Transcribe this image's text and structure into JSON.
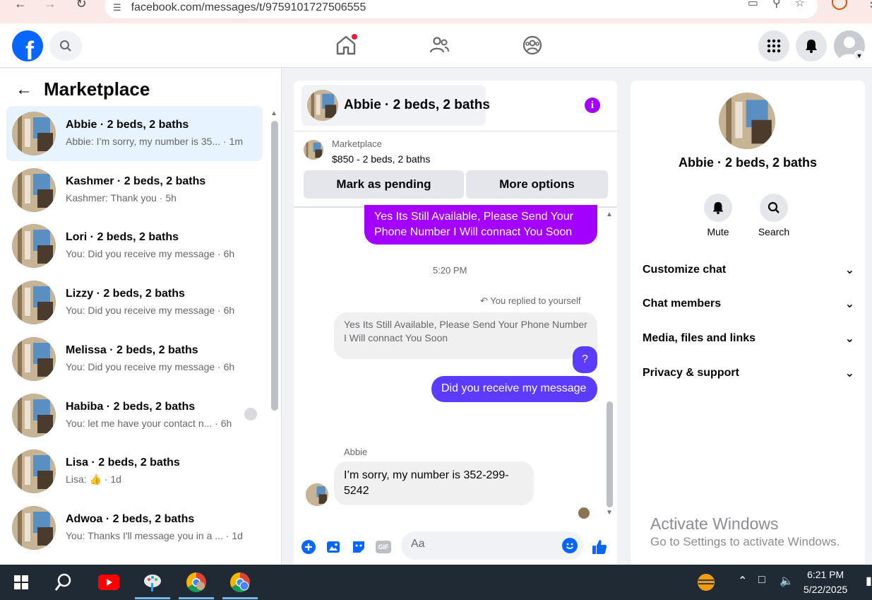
{
  "browser": {
    "url": "facebook.com/messages/t/9759101727506555"
  },
  "topbar": {
    "logo_letter": "f"
  },
  "left": {
    "title": "Marketplace",
    "conversations": [
      {
        "name": "Abbie · 2 beds, 2 baths",
        "preview": "Abbie: I’m sorry, my number is 35... · 1m"
      },
      {
        "name": "Kashmer · 2 beds, 2 baths",
        "preview": "Kashmer: Thank you · 5h"
      },
      {
        "name": "Lori · 2 beds, 2 baths",
        "preview": "You: Did you receive my message · 6h"
      },
      {
        "name": "Lizzy · 2 beds, 2 baths",
        "preview": "You: Did you receive my message · 6h"
      },
      {
        "name": "Melissa · 2 beds, 2 baths",
        "preview": "You: Did you receive my message · 6h"
      },
      {
        "name": "Habiba · 2 beds, 2 baths",
        "preview": "You: let me have your contact n... · 6h"
      },
      {
        "name": "Lisa · 2 beds, 2 baths",
        "preview_prefix": "Lisa:",
        "preview_suffix": "· 1d"
      },
      {
        "name": "Adwoa · 2 beds, 2 baths",
        "preview": "You: Thanks I'll message you in a ... · 1d"
      }
    ]
  },
  "chat": {
    "title": "Abbie · 2 beds, 2 baths",
    "info_glyph": "i",
    "marketplace_label": "Marketplace",
    "listing": "$850 - 2 beds, 2 baths",
    "mark_pending": "Mark as pending",
    "more_options": "More options",
    "messages": {
      "out1": "Yes Its Still Available, Please Send Your Phone Number I Will connact You Soon",
      "time": "5:20 PM",
      "replied_note": "You replied to yourself",
      "reply_quote": "Yes Its Still Available, Please Send Your Phone Number I Will connact You Soon",
      "out_q": "?",
      "out2": "Did you receive my message",
      "sender": "Abbie",
      "in1": "I’m sorry, my number is 352-299-5242"
    },
    "composer_placeholder": "Aa",
    "gif_label": "GIF"
  },
  "info_panel": {
    "name": "Abbie · 2 beds, 2 baths",
    "mute": "Mute",
    "search": "Search",
    "sections": [
      "Customize chat",
      "Chat members",
      "Media, files and links",
      "Privacy & support"
    ]
  },
  "watermark": {
    "line1": "Activate Windows",
    "line2": "Go to Settings to activate Windows."
  },
  "taskbar": {
    "time": "6:21 PM",
    "date": "5/22/2025"
  },
  "colors": {
    "fb_blue": "#0866ff",
    "messenger_purple": "#a400ff",
    "messenger_indigo": "#5b3cff",
    "active_bg": "#e7f3ff"
  }
}
